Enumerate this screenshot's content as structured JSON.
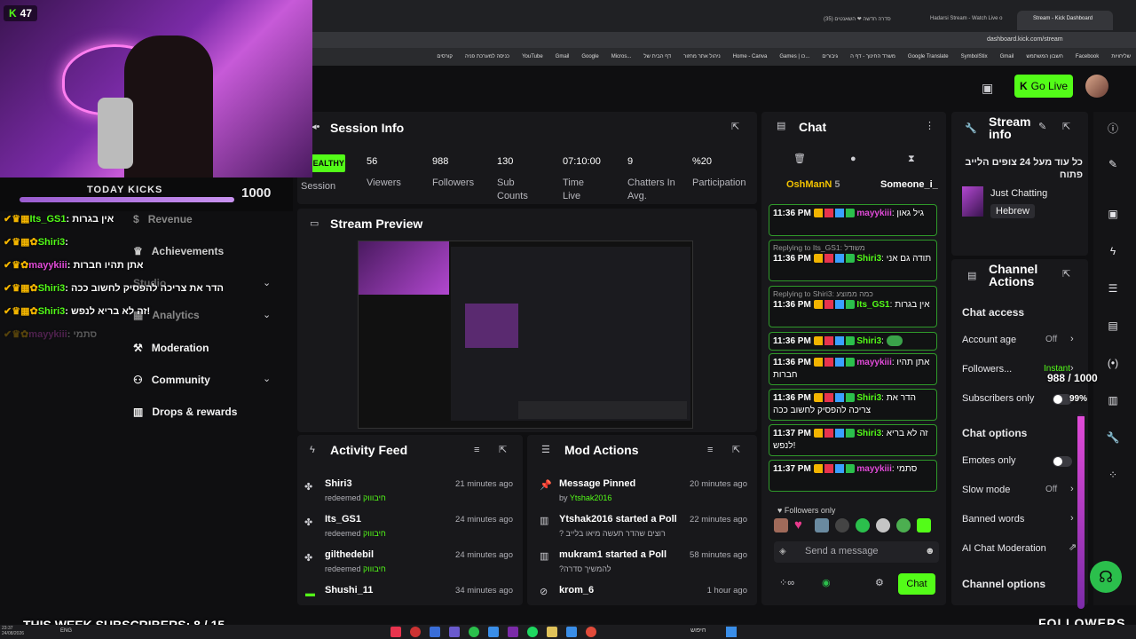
{
  "browser": {
    "tabs": [
      {
        "label": "Stream - Kick Dashboard",
        "active": true
      },
      {
        "label": "Hadarsi Stream - Watch Live o",
        "active": false
      },
      {
        "label": "סדרה חדשה ❤ השאנטים (35)",
        "active": false
      }
    ],
    "url": "dashboard.kick.com/stream",
    "bookmarks": [
      "שליחויות",
      "Facebook",
      "חשבון המשתמש",
      "Gmail",
      "SymbolStix",
      "Google Translate",
      "משרד החינוך - דף ה",
      "גיבורים",
      "Games | כו...",
      "Home - Canva",
      "ניהול אתר מחזור",
      "דף הבית של",
      "Micros...",
      "Google",
      "Gmail",
      "YouTube",
      "כניסה למערכת פניה",
      "קורסים",
      "Photopea"
    ]
  },
  "header": {
    "go_live_label": "Go Live"
  },
  "session_info": {
    "title": "Session Info",
    "health": "HEALTHY",
    "session_label": "Session",
    "stats": [
      {
        "value": "56",
        "label": "Viewers"
      },
      {
        "value": "988",
        "label": "Followers"
      },
      {
        "value": "130",
        "label": "Sub Counts"
      },
      {
        "value": "07:10:00",
        "label": "Time Live"
      },
      {
        "value": "9",
        "label": "Chatters In Avg."
      },
      {
        "value": "%20",
        "label": "Participation"
      }
    ]
  },
  "stream_preview": {
    "title": "Stream Preview"
  },
  "sidebar_menu": {
    "items": [
      "Revenue",
      "Achievements",
      "Studio",
      "Analytics",
      "Moderation",
      "Community",
      "Drops & rewards"
    ]
  },
  "activity_feed": {
    "title": "Activity Feed",
    "items": [
      {
        "name": "Shiri3",
        "sub": "redeemed",
        "reward": "חיבוווק",
        "time": "21 minutes ago"
      },
      {
        "name": "Its_GS1",
        "sub": "redeemed",
        "reward": "חיבוווק",
        "time": "24 minutes ago"
      },
      {
        "name": "gilthedebil",
        "sub": "redeemed",
        "reward": "חיבוווק",
        "time": "24 minutes ago"
      },
      {
        "name": "Shushi_11",
        "sub": "",
        "reward": "",
        "time": "34 minutes ago"
      }
    ]
  },
  "mod_actions": {
    "title": "Mod Actions",
    "items": [
      {
        "title": "Message Pinned",
        "sub": "by",
        "user": "Ytshak2016",
        "time": "20 minutes ago"
      },
      {
        "title": "Ytshak2016 started a Poll",
        "sub": "? רוצים שהדר תעשה מיאו בלייב",
        "time": "22 minutes ago"
      },
      {
        "title": "mukram1 started a Poll",
        "sub": "?להמשיך סדרה",
        "time": "58 minutes ago"
      },
      {
        "title": "krom_6",
        "sub": "",
        "time": "1 hour ago"
      }
    ]
  },
  "chat": {
    "title": "Chat",
    "top_chatters": [
      {
        "name": "OshManN",
        "count": "5"
      },
      {
        "name": "Someone_i_",
        "count": ""
      }
    ],
    "messages": [
      {
        "time": "11:36 PM",
        "user": "mayykiii",
        "color": "pink",
        "text": "גיל גאון",
        "reply": ""
      },
      {
        "time": "11:36 PM",
        "user": "Shiri3",
        "color": "green",
        "text": "תודה גם אני",
        "reply": "Replying to Its_GS1: משודל"
      },
      {
        "time": "11:36 PM",
        "user": "Its_GS1",
        "color": "green",
        "text": "אין בגרות",
        "reply": "Replying to Shiri3: כמה ממוצע"
      },
      {
        "time": "11:36 PM",
        "user": "Shiri3",
        "color": "green",
        "text": "",
        "reply": ""
      },
      {
        "time": "11:36 PM",
        "user": "mayykiii",
        "color": "pink",
        "text": "אתן תהיו חברות",
        "reply": ""
      },
      {
        "time": "11:36 PM",
        "user": "Shiri3",
        "color": "green",
        "text": "הדר את צריכה להפסיק לחשוב ככה",
        "reply": ""
      },
      {
        "time": "11:37 PM",
        "user": "Shiri3",
        "color": "green",
        "text": "זה לא בריא לנפש!",
        "reply": ""
      },
      {
        "time": "11:37 PM",
        "user": "mayykiii",
        "color": "pink",
        "text": "סתמי",
        "reply": ""
      }
    ],
    "followers_only": "Followers only",
    "input_placeholder": "Send a message",
    "send_label": "Chat"
  },
  "stream_info": {
    "title": "Stream info",
    "stream_title": "כל עוד מעל 24 צופים הלייב פתוח",
    "category": "Just Chatting",
    "tag": "Hebrew"
  },
  "channel_actions": {
    "title": "Channel Actions",
    "chat_access_label": "Chat access",
    "rows": [
      {
        "label": "Account age",
        "value": "Off"
      },
      {
        "label": "Followers...",
        "value": "Instant"
      },
      {
        "label": "Subscribers only",
        "value": ""
      }
    ],
    "chat_options_label": "Chat options",
    "rows2": [
      {
        "label": "Emotes only",
        "value": ""
      },
      {
        "label": "Slow mode",
        "value": "Off"
      },
      {
        "label": "Banned words",
        "value": ""
      },
      {
        "label": "AI Chat Moderation",
        "value": ""
      }
    ],
    "channel_options_label": "Channel options"
  },
  "overlay": {
    "kick_count": "47",
    "today_kicks_label": "TODAY KICKS",
    "today_kicks_value": "1000",
    "chat_lines": [
      {
        "user": "Its_GS1",
        "text": "אין בגרות"
      },
      {
        "user": "Shiri3",
        "text": ""
      },
      {
        "user": "mayykiii",
        "text": "אתן תהיו חברות"
      },
      {
        "user": "Shiri3",
        "text": "הדר את צריכה להפסיק לחשוב ככה"
      },
      {
        "user": "Shiri3",
        "text": "זה לא בריא לנפש!"
      },
      {
        "user": "mayykiii",
        "text": "סתמי"
      }
    ],
    "followers_goal": "988 / 1000",
    "followers_progress": 0.988,
    "followers_pct": "99%",
    "followers_label": "FOLLOWERS",
    "week_subs": "THIS WEEK SUBSCRIBERS: 8 / 15"
  },
  "taskbar": {
    "lang": "ENG",
    "time": "23:37",
    "date": "24/08/2026",
    "search": "חיפוש"
  }
}
